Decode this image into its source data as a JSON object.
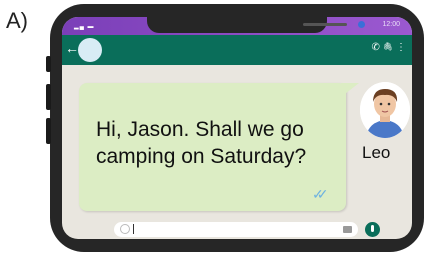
{
  "figure_label": "A)",
  "status_bar": {
    "time": "12:00",
    "signal": "▂▄ ▬"
  },
  "chat": {
    "message": "Hi, Jason. Shall we go camping on Saturday?",
    "sender_name": "Leo",
    "read_receipt": "✓✓"
  },
  "app_bar_icons": {
    "call": "✆",
    "attach": "🖇",
    "menu": "⋮"
  },
  "icons": [
    "back-arrow-icon",
    "avatar-icon",
    "call-icon",
    "attach-icon",
    "menu-icon",
    "emoji-icon",
    "camera-icon",
    "mic-icon"
  ],
  "colors": {
    "app_bar": "#0a6e5a",
    "bubble": "#dcedc4",
    "status_bar": "#8a4cc4",
    "chat_bg": "#e9e6df"
  }
}
